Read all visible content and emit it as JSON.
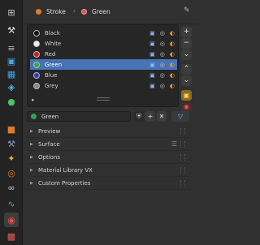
{
  "header": {
    "object_name": "Stroke",
    "material_name": "Green"
  },
  "strip_tabs": [
    {
      "name": "tool-icon",
      "glyph": "⊞",
      "color": "#c9c9c9"
    },
    {
      "name": "wrench-icon",
      "glyph": "⚒",
      "color": "#e0e0e0"
    },
    {
      "name": "sliders-icon",
      "glyph": "≡",
      "color": "#bfbfbf"
    },
    {
      "name": "render-icon",
      "glyph": "▣",
      "color": "#4fa3e0"
    },
    {
      "name": "image-icon",
      "glyph": "▦",
      "color": "#3fa6e8"
    },
    {
      "name": "view-layer-icon",
      "glyph": "◈",
      "color": "#4fb3e0"
    },
    {
      "name": "world-icon",
      "glyph": "●",
      "color": "#4ac16b"
    },
    {
      "name": "object-icon",
      "glyph": "■",
      "color": "#e07b27"
    },
    {
      "name": "modifier-icon",
      "glyph": "⚒",
      "color": "#7a9bcc"
    },
    {
      "name": "particles-icon",
      "glyph": "✦",
      "color": "#e4b33a"
    },
    {
      "name": "physics-icon",
      "glyph": "◎",
      "color": "#e07b27"
    },
    {
      "name": "constraints-icon",
      "glyph": "∞",
      "color": "#cfcfcf"
    },
    {
      "name": "data-icon",
      "glyph": "∿",
      "color": "#4bbd7a"
    },
    {
      "name": "material-icon",
      "glyph": "◉",
      "color": "#e34d4d"
    },
    {
      "name": "texture-icon",
      "glyph": "▩",
      "color": "#e05a5a"
    }
  ],
  "slots": [
    {
      "label": "Black",
      "color": "#111111"
    },
    {
      "label": "White",
      "color": "#f0f0f0"
    },
    {
      "label": "Red",
      "color": "#cc1f1f"
    },
    {
      "label": "Green",
      "color": "#2aa84a"
    },
    {
      "label": "Blue",
      "color": "#2a3fcc"
    },
    {
      "label": "Grey",
      "color": "#8a8a8a"
    }
  ],
  "material_selector": {
    "name": "Green",
    "shield_glyph": "⛨",
    "add_glyph": "+",
    "remove_glyph": "✕",
    "browse_glyph": "▽"
  },
  "panels": [
    {
      "label": "Preview"
    },
    {
      "label": "Surface"
    },
    {
      "label": "Options"
    },
    {
      "label": "Material Library VX"
    },
    {
      "label": "Custom Properties"
    }
  ],
  "right_controls": {
    "add": "+",
    "remove": "−",
    "specials": "⌄",
    "up": "⌃",
    "down": "⌄",
    "lock": "▣"
  }
}
